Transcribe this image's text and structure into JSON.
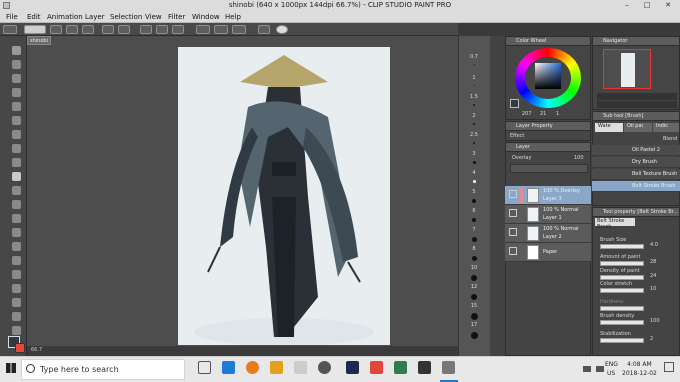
{
  "window": {
    "title": "shinobi (640 x 1000px 144dpi 66.7%) - CLIP STUDIO PAINT PRO",
    "minimize": "–",
    "maximize": "□",
    "close": "✕"
  },
  "menu": [
    "File",
    "Edit",
    "Animation",
    "Layer",
    "Selection",
    "View",
    "Filter",
    "Window",
    "Help"
  ],
  "canvas": {
    "tab": "shinobi",
    "zoom": "66.7"
  },
  "ruler": {
    "labels": [
      "0.7",
      "1",
      "1.5",
      "2",
      "2.5",
      "3",
      "4",
      "5",
      "6",
      "7",
      "8",
      "10",
      "12",
      "15",
      "17"
    ]
  },
  "color_wheel": {
    "title": "Color Wheel",
    "values": [
      "207",
      "21",
      "1"
    ],
    "current_color": "#2e3a44"
  },
  "layer_property": {
    "tab": "Layer Property",
    "effect": "Effect"
  },
  "layer_panel": {
    "tab": "Layer",
    "blend": "Overlay",
    "opacity": "100",
    "layers": [
      {
        "meta": "100 % Overlay",
        "name": "Layer 3"
      },
      {
        "meta": "100 % Normal",
        "name": "Layer 1"
      },
      {
        "meta": "100 % Normal",
        "name": "Layer 2"
      },
      {
        "meta": "",
        "name": "Paper"
      }
    ]
  },
  "navigator": {
    "title": "Navigator",
    "zoom": "66.7",
    "rotation": "0.0"
  },
  "sub_tool": {
    "title": "Sub tool [Brush]",
    "tabs": [
      "Wate",
      "Oil pai",
      "Indic"
    ],
    "group": "Blend",
    "brushes": [
      "Oil Pastel 2",
      "Dry Brush",
      "Bell Texture Brush",
      "Belt Stroke Brush"
    ]
  },
  "tool_property": {
    "title": "Tool property [Belt Stroke Br...",
    "tool_name": "Belt Stroke Brush",
    "props": [
      {
        "label": "Brush Size",
        "value": "4.0"
      },
      {
        "label": "Amount of paint",
        "value": "28"
      },
      {
        "label": "Density of paint",
        "value": "24"
      },
      {
        "label": "Color stretch",
        "value": "10"
      },
      {
        "label": "Hardness",
        "value": ""
      },
      {
        "label": "Brush density",
        "value": "100"
      },
      {
        "label": "Stabilization",
        "value": "2"
      }
    ]
  },
  "taskbar": {
    "search_placeholder": "Type here to search",
    "lang": "ENG",
    "region": "US",
    "time": "4:08 AM",
    "date": "2018-12-02"
  }
}
